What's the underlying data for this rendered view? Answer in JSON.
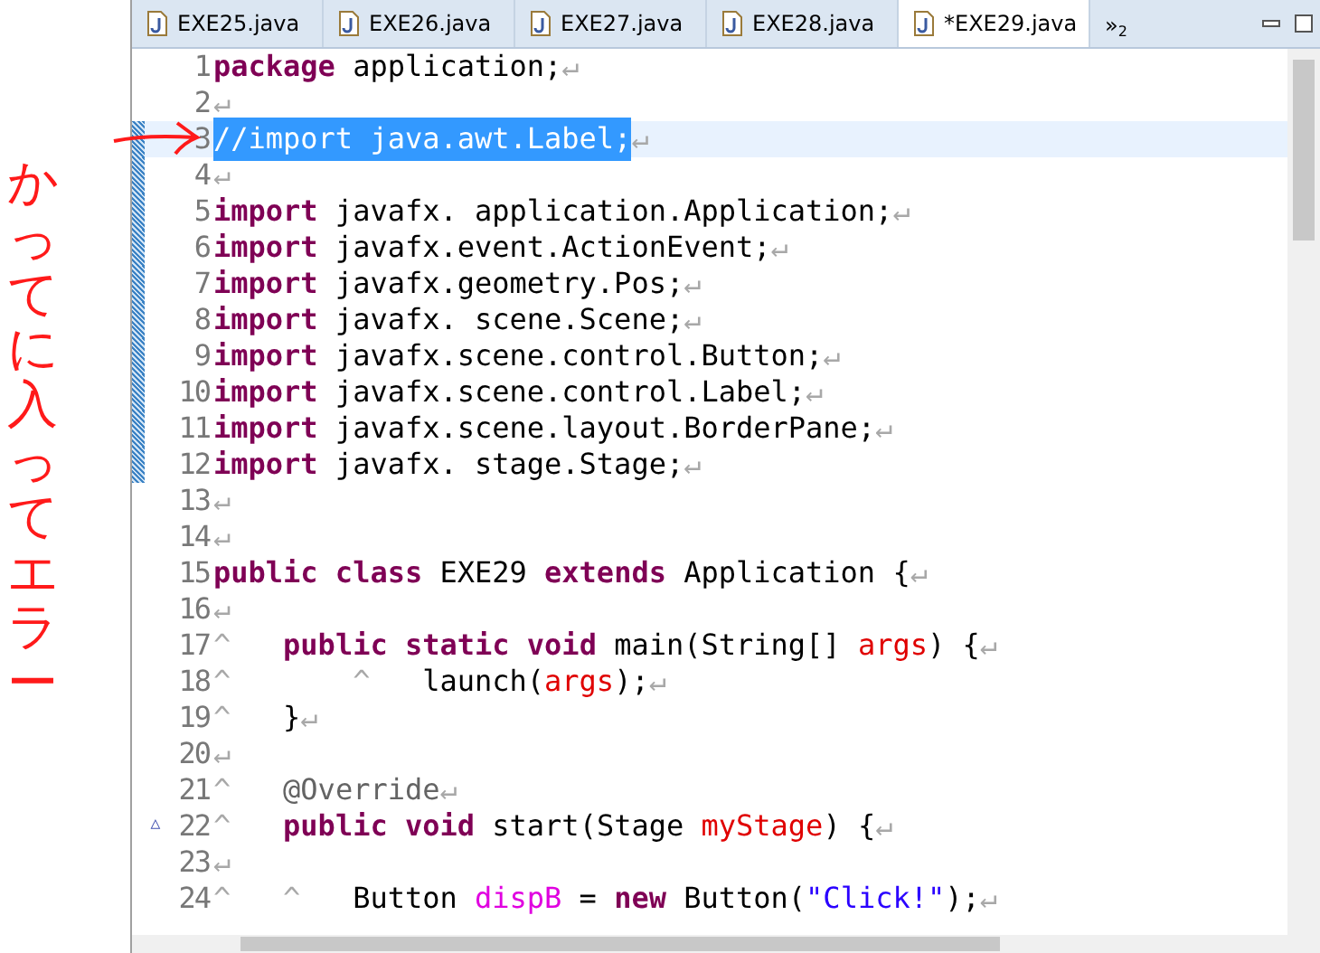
{
  "annotation": {
    "text": "かってに入ってエラー"
  },
  "tabs": [
    {
      "label": "EXE25.java",
      "selected": false
    },
    {
      "label": "EXE26.java",
      "selected": false
    },
    {
      "label": "EXE27.java",
      "selected": false
    },
    {
      "label": "EXE28.java",
      "selected": false
    },
    {
      "label": "*EXE29.java",
      "selected": true
    }
  ],
  "overflow": {
    "symbol": "»",
    "count": "2"
  },
  "lines": [
    {
      "number": "1",
      "current": false,
      "ruler": false,
      "tokens": [
        {
          "kind": "kw",
          "text": "package"
        },
        {
          "kind": "plain",
          "text": " application;"
        },
        {
          "kind": "mark",
          "text": "↵"
        }
      ]
    },
    {
      "number": "2",
      "current": false,
      "ruler": false,
      "tokens": [
        {
          "kind": "mark",
          "text": "↵"
        }
      ]
    },
    {
      "number": "3",
      "current": true,
      "ruler": true,
      "tokens": [
        {
          "kind": "sel",
          "text": "//import java.awt.Label;"
        },
        {
          "kind": "mark",
          "text": "↵"
        }
      ]
    },
    {
      "number": "4",
      "current": false,
      "ruler": true,
      "tokens": [
        {
          "kind": "mark",
          "text": "↵"
        }
      ]
    },
    {
      "number": "5",
      "current": false,
      "ruler": true,
      "tokens": [
        {
          "kind": "kw",
          "text": "import"
        },
        {
          "kind": "plain",
          "text": " javafx. application.Application;"
        },
        {
          "kind": "mark",
          "text": "↵"
        }
      ]
    },
    {
      "number": "6",
      "current": false,
      "ruler": true,
      "tokens": [
        {
          "kind": "kw",
          "text": "import"
        },
        {
          "kind": "plain",
          "text": " javafx.event.ActionEvent;"
        },
        {
          "kind": "mark",
          "text": "↵"
        }
      ]
    },
    {
      "number": "7",
      "current": false,
      "ruler": true,
      "tokens": [
        {
          "kind": "kw",
          "text": "import"
        },
        {
          "kind": "plain",
          "text": " javafx.geometry.Pos;"
        },
        {
          "kind": "mark",
          "text": "↵"
        }
      ]
    },
    {
      "number": "8",
      "current": false,
      "ruler": true,
      "tokens": [
        {
          "kind": "kw",
          "text": "import"
        },
        {
          "kind": "plain",
          "text": " javafx. scene.Scene;"
        },
        {
          "kind": "mark",
          "text": "↵"
        }
      ]
    },
    {
      "number": "9",
      "current": false,
      "ruler": true,
      "tokens": [
        {
          "kind": "kw",
          "text": "import"
        },
        {
          "kind": "plain",
          "text": " javafx.scene.control.Button;"
        },
        {
          "kind": "mark",
          "text": "↵"
        }
      ]
    },
    {
      "number": "10",
      "current": false,
      "ruler": true,
      "tokens": [
        {
          "kind": "kw",
          "text": "import"
        },
        {
          "kind": "plain",
          "text": " javafx.scene.control.Label;"
        },
        {
          "kind": "mark",
          "text": "↵"
        }
      ]
    },
    {
      "number": "11",
      "current": false,
      "ruler": true,
      "tokens": [
        {
          "kind": "kw",
          "text": "import"
        },
        {
          "kind": "plain",
          "text": " javafx.scene.layout.BorderPane;"
        },
        {
          "kind": "mark",
          "text": "↵"
        }
      ]
    },
    {
      "number": "12",
      "current": false,
      "ruler": true,
      "tokens": [
        {
          "kind": "kw",
          "text": "import"
        },
        {
          "kind": "plain",
          "text": " javafx. stage.Stage;"
        },
        {
          "kind": "mark",
          "text": "↵"
        }
      ]
    },
    {
      "number": "13",
      "current": false,
      "ruler": false,
      "tokens": [
        {
          "kind": "mark",
          "text": "↵"
        }
      ]
    },
    {
      "number": "14",
      "current": false,
      "ruler": false,
      "tokens": [
        {
          "kind": "mark",
          "text": "↵"
        }
      ]
    },
    {
      "number": "15",
      "current": false,
      "ruler": false,
      "tokens": [
        {
          "kind": "kw",
          "text": "public"
        },
        {
          "kind": "kw",
          "text": " class"
        },
        {
          "kind": "plain",
          "text": " EXE29 "
        },
        {
          "kind": "kw",
          "text": "extends"
        },
        {
          "kind": "plain",
          "text": " Application {"
        },
        {
          "kind": "mark",
          "text": "↵"
        }
      ]
    },
    {
      "number": "16",
      "current": false,
      "ruler": false,
      "tokens": [
        {
          "kind": "mark",
          "text": "↵"
        }
      ]
    },
    {
      "number": "17",
      "current": false,
      "ruler": false,
      "tokens": [
        {
          "kind": "mark",
          "text": "^"
        },
        {
          "kind": "kw",
          "text": "   public"
        },
        {
          "kind": "kw",
          "text": " static"
        },
        {
          "kind": "kw",
          "text": " void"
        },
        {
          "kind": "plain",
          "text": " main(String[] "
        },
        {
          "kind": "param",
          "text": "args"
        },
        {
          "kind": "plain",
          "text": ") {"
        },
        {
          "kind": "mark",
          "text": "↵"
        }
      ]
    },
    {
      "number": "18",
      "current": false,
      "ruler": false,
      "tokens": [
        {
          "kind": "mark",
          "text": "^       ^"
        },
        {
          "kind": "plain",
          "text": "   launch("
        },
        {
          "kind": "param",
          "text": "args"
        },
        {
          "kind": "plain",
          "text": ");"
        },
        {
          "kind": "mark",
          "text": "↵"
        }
      ]
    },
    {
      "number": "19",
      "current": false,
      "ruler": false,
      "tokens": [
        {
          "kind": "mark",
          "text": "^"
        },
        {
          "kind": "plain",
          "text": "   }"
        },
        {
          "kind": "mark",
          "text": "↵"
        }
      ]
    },
    {
      "number": "20",
      "current": false,
      "ruler": false,
      "tokens": [
        {
          "kind": "mark",
          "text": "↵"
        }
      ]
    },
    {
      "number": "21",
      "current": false,
      "ruler": false,
      "tokens": [
        {
          "kind": "mark",
          "text": "^"
        },
        {
          "kind": "annot",
          "text": "   @Override"
        },
        {
          "kind": "mark",
          "text": "↵"
        }
      ]
    },
    {
      "number": "22",
      "current": false,
      "ruler": false,
      "gutter_mark": "△",
      "tokens": [
        {
          "kind": "mark",
          "text": "^"
        },
        {
          "kind": "kw",
          "text": "   public"
        },
        {
          "kind": "kw",
          "text": " void"
        },
        {
          "kind": "plain",
          "text": " start(Stage "
        },
        {
          "kind": "param",
          "text": "myStage"
        },
        {
          "kind": "plain",
          "text": ") {"
        },
        {
          "kind": "mark",
          "text": "↵"
        }
      ]
    },
    {
      "number": "23",
      "current": false,
      "ruler": false,
      "tokens": [
        {
          "kind": "mark",
          "text": "↵"
        }
      ]
    },
    {
      "number": "24",
      "current": false,
      "ruler": false,
      "tokens": [
        {
          "kind": "mark",
          "text": "^   ^"
        },
        {
          "kind": "plain",
          "text": "   Button "
        },
        {
          "kind": "local",
          "text": "dispB"
        },
        {
          "kind": "plain",
          "text": " = "
        },
        {
          "kind": "kw",
          "text": "new"
        },
        {
          "kind": "plain",
          "text": " Button("
        },
        {
          "kind": "string",
          "text": "\"Click!\""
        },
        {
          "kind": "plain",
          "text": ");"
        },
        {
          "kind": "mark",
          "text": "↵"
        }
      ]
    }
  ]
}
